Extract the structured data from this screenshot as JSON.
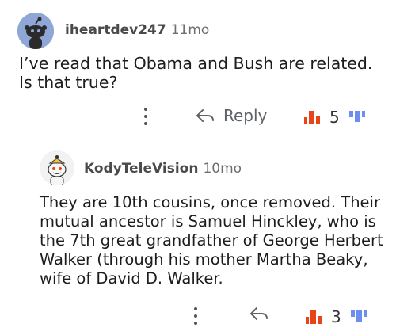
{
  "comments": [
    {
      "username": "iheartdev247",
      "age": "11mo",
      "body": "I’ve read that Obama and Bush are related. Is that true?",
      "reply_label": "Reply",
      "score": "5",
      "colors": {
        "upvote": "#e8441a",
        "downvote": "#6b8ef0"
      }
    },
    {
      "username": "KodyTeleVision",
      "age": "10mo",
      "body": "They are 10th cousins, once removed. Their mutual ancestor is Samuel Hinckley, who is the 7th great grandfather of George Herbert Walker (through his mother Martha Beaky, wife of David D. Walker.",
      "score": "3"
    }
  ]
}
